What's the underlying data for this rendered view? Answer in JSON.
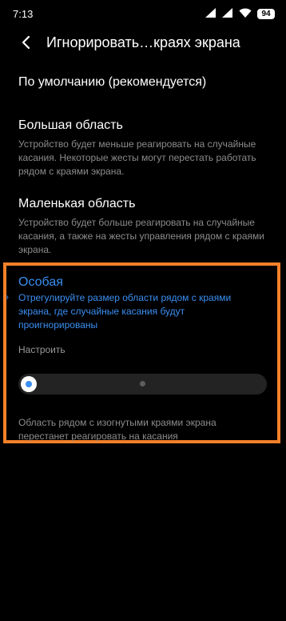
{
  "status_bar": {
    "time": "7:13",
    "battery": "94",
    "icons": [
      "cellular-signal-icon",
      "cellular-signal-icon",
      "wifi-icon",
      "battery-icon"
    ]
  },
  "header": {
    "back_icon": "back-arrow-icon",
    "title": "Игнорировать…краях экрана"
  },
  "options": [
    {
      "title": "По умолчанию (рекомендуется)",
      "description": ""
    },
    {
      "title": "Большая область",
      "description": "Устройство будет меньше реагировать на случайные касания. Некоторые жесты могут перестать работать рядом с краями экрана."
    },
    {
      "title": "Маленькая область",
      "description": "Устройство будет больше реагировать на случайные касания, а также на жесты управления рядом с краями экрана."
    }
  ],
  "custom": {
    "title": "Особая",
    "description": "Отрегулируйте размер области рядом с краями экрана, где случайные касания будут проигнорированы",
    "configure_label": "Настроить",
    "slider_value_percent": 0,
    "footer_note": "Область рядом с изогнутыми краями экрана перестанет реагировать на касания"
  },
  "colors": {
    "accent": "#3a8ff2",
    "highlight": "#f5812a",
    "background": "#000000"
  }
}
